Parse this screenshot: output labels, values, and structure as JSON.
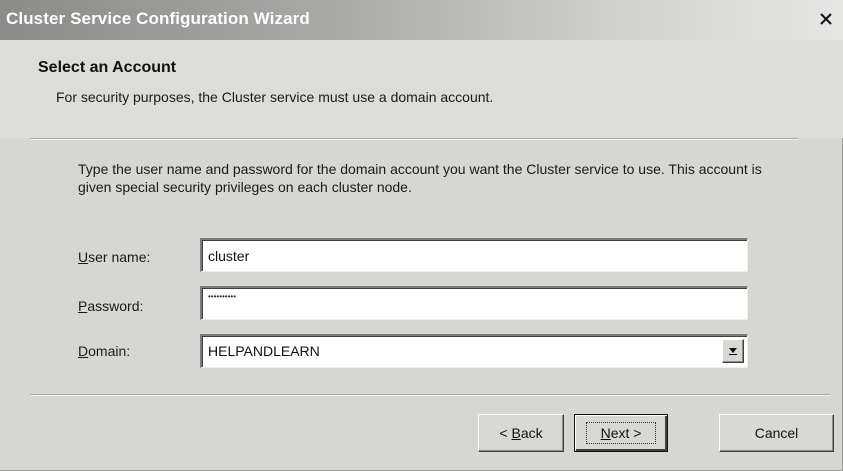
{
  "window": {
    "title": "Cluster Service Configuration Wizard",
    "close_glyph": "×"
  },
  "header": {
    "title": "Select an Account",
    "subtitle": "For security purposes, the Cluster service must use a domain account."
  },
  "body": {
    "instructions": "Type the user name and password for the domain account you want the Cluster service to use. This account is given special security privileges on each cluster node."
  },
  "form": {
    "username": {
      "label_accel": "U",
      "label_rest": "ser name:",
      "value": "cluster"
    },
    "password": {
      "label_accel": "P",
      "label_rest": "assword:",
      "value": "••••••••••"
    },
    "domain": {
      "label_accel": "D",
      "label_rest": "omain:",
      "value": "HELPANDLEARN"
    }
  },
  "buttons": {
    "back_prefix": "< ",
    "back_accel": "B",
    "back_rest": "ack",
    "next_accel": "N",
    "next_rest": "ext >",
    "cancel": "Cancel"
  },
  "icons": {
    "close": "close-icon",
    "dropdown": "chevron-down-icon"
  }
}
